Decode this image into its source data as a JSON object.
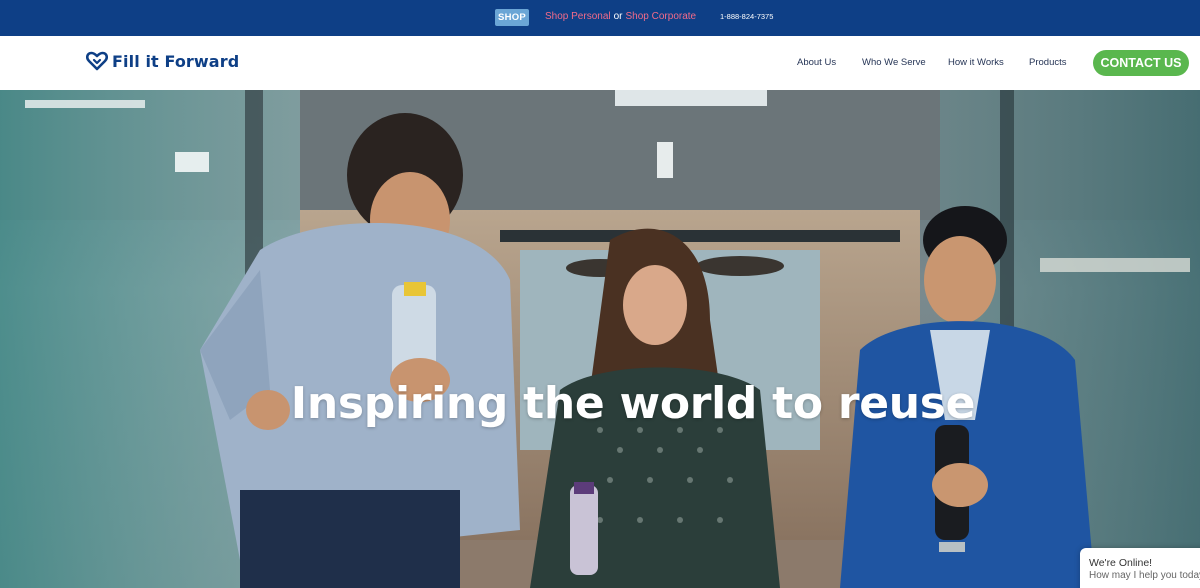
{
  "topbar": {
    "shop_badge": "SHOP",
    "shop_personal": "Shop Personal",
    "or": "or",
    "shop_corporate": "Shop Corporate",
    "phone": "1-888-824-7375"
  },
  "header": {
    "logo_text": "Fill it Forward",
    "nav": [
      "About Us",
      "Who We Serve",
      "How it Works",
      "Products"
    ],
    "contact_label": "CONTACT US"
  },
  "hero": {
    "title": "Inspiring the world to reuse",
    "icons": [
      "heart-logo-icon"
    ]
  },
  "chat": {
    "line1": "We're Online!",
    "line2": "How may I help you today?"
  },
  "colors": {
    "topbar_bg": "#0e3f86",
    "shop_badge": "#6ba6d6",
    "shop_links": "#f26b8a",
    "brand_navy": "#0e3f86",
    "contact_green": "#5ab74e"
  }
}
